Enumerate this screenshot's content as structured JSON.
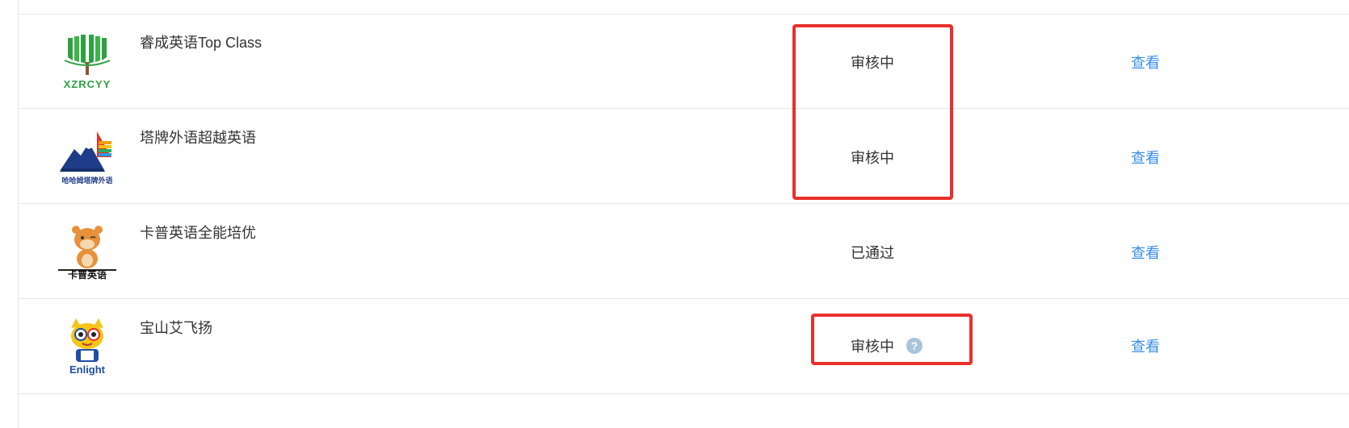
{
  "rows": [
    {
      "name": "睿成英语Top Class",
      "status": "审核中",
      "action": "查看",
      "logo_text": "XZRCYY",
      "logo_icon": "book-tree-logo"
    },
    {
      "name": "塔牌外语超越英语",
      "status": "审核中",
      "action": "查看",
      "logo_text": "哈哈姆塔牌外语",
      "logo_icon": "mountain-stripes-logo"
    },
    {
      "name": "卡普英语全能培优",
      "status": "已通过",
      "action": "查看",
      "logo_text": "卡普英语",
      "logo_icon": "hamster-mascot-logo"
    },
    {
      "name": "宝山艾飞扬",
      "status": "审核中",
      "action": "查看",
      "logo_text": "Enlight",
      "logo_icon": "cartoon-cat-mascot-logo",
      "has_help_icon": true
    }
  ],
  "colors": {
    "status_text": "#333333",
    "action_link": "#3a8ee6",
    "highlight_border": "#e8302a",
    "row_border": "#e6e6e6",
    "help_icon": "#a9c3dc"
  }
}
